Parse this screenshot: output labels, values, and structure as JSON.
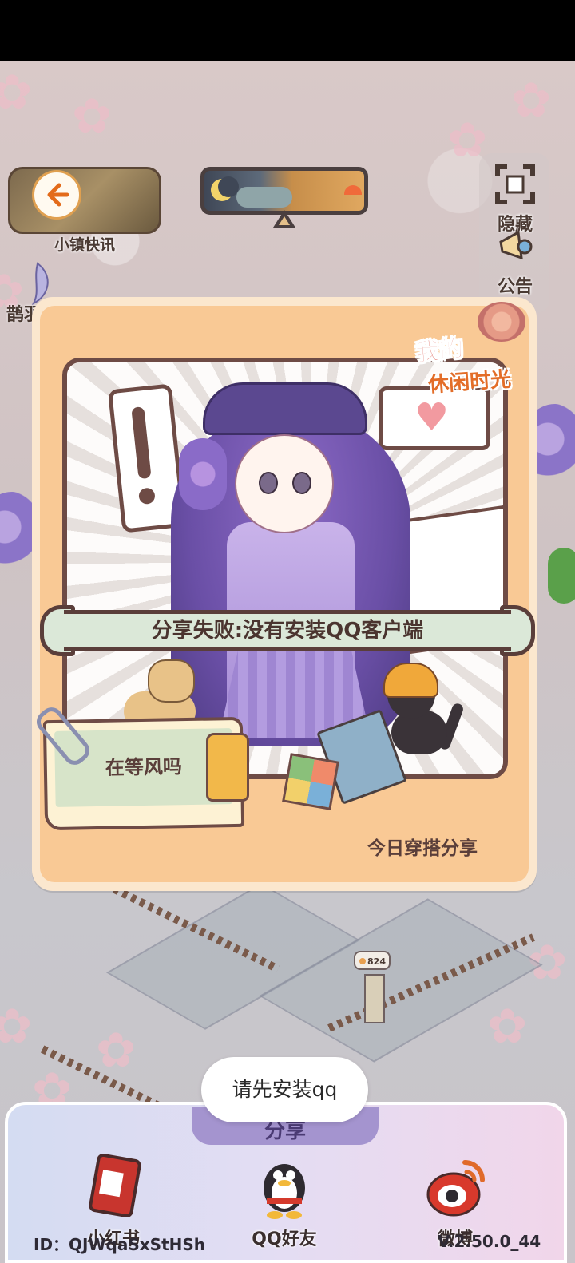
{
  "top_hud": {
    "news": {
      "label": "小镇快讯",
      "icon": "back-arrow-icon"
    },
    "weather": {
      "icon": "day-night-weather-icon"
    },
    "side_buttons": [
      {
        "label": "隐藏",
        "icon": "hide-frame-icon"
      },
      {
        "label": "公告",
        "icon": "announcement-megaphone-icon"
      }
    ],
    "left_partial_label": "鹊羽"
  },
  "share_card": {
    "logo_line1": "我的",
    "logo_line2": "休闲时光",
    "error_banner": "分享失败:没有安装QQ客户端",
    "note_text": "在等风吗",
    "footer_caption": "今日穿搭分享"
  },
  "world": {
    "counter_value": "824"
  },
  "toast": {
    "message": "请先安装qq"
  },
  "share_panel": {
    "title": "分享",
    "options": [
      {
        "label": "小红书",
        "icon": "xiaohongshu-book-icon"
      },
      {
        "label": "QQ好友",
        "icon": "qq-penguin-icon"
      },
      {
        "label": "微博",
        "icon": "weibo-eye-icon"
      }
    ],
    "user_id": "ID：QJWqaSxStHSh",
    "version": "V.2.50.0_44"
  },
  "colors": {
    "card_bg": "#f9c995",
    "banner_bg": "#dbe8d8",
    "border_brown": "#6e4b45",
    "panel_purple": "#a494cf"
  }
}
